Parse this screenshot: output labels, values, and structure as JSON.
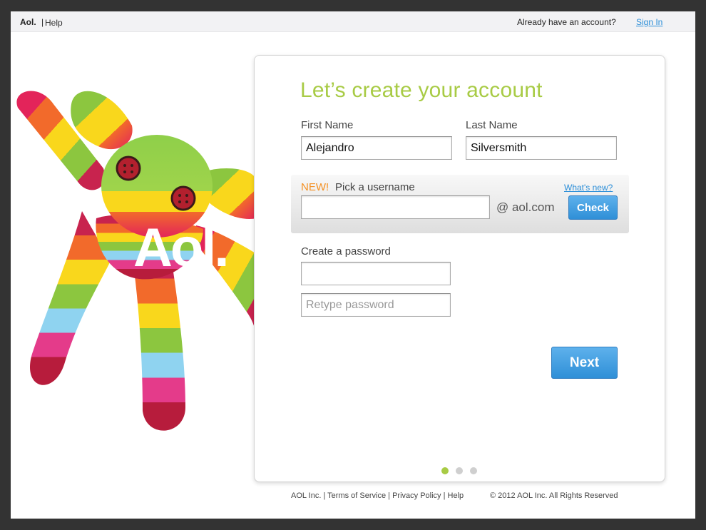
{
  "topbar": {
    "brand": "Aol.",
    "separator": "|",
    "help": "Help",
    "already": "Already have an account?",
    "signin": "Sign In"
  },
  "mascot": {
    "overlay_text": "Aol."
  },
  "form": {
    "title": "Let’s create your account",
    "first_name_label": "First Name",
    "first_name_value": "Alejandro",
    "last_name_label": "Last Name",
    "last_name_value": "Silversmith",
    "new_tag": "NEW!",
    "username_label": "Pick a username",
    "whats_new": "What's new?",
    "username_value": "",
    "domain": "@ aol.com",
    "check_label": "Check",
    "password_label": "Create a password",
    "password_value": "",
    "retype_placeholder": "Retype password",
    "next_label": "Next",
    "steps_total": 3,
    "step_active": 1
  },
  "footer": {
    "company": "AOL Inc.",
    "terms": "Terms of Service",
    "privacy": "Privacy Policy",
    "help": "Help",
    "copyright": "© 2012  AOL Inc. All Rights Reserved"
  },
  "colors": {
    "accent_green": "#a8cb45",
    "new_orange": "#f49022",
    "link_blue": "#2b8ed8",
    "button_blue": "#3a97dc"
  }
}
